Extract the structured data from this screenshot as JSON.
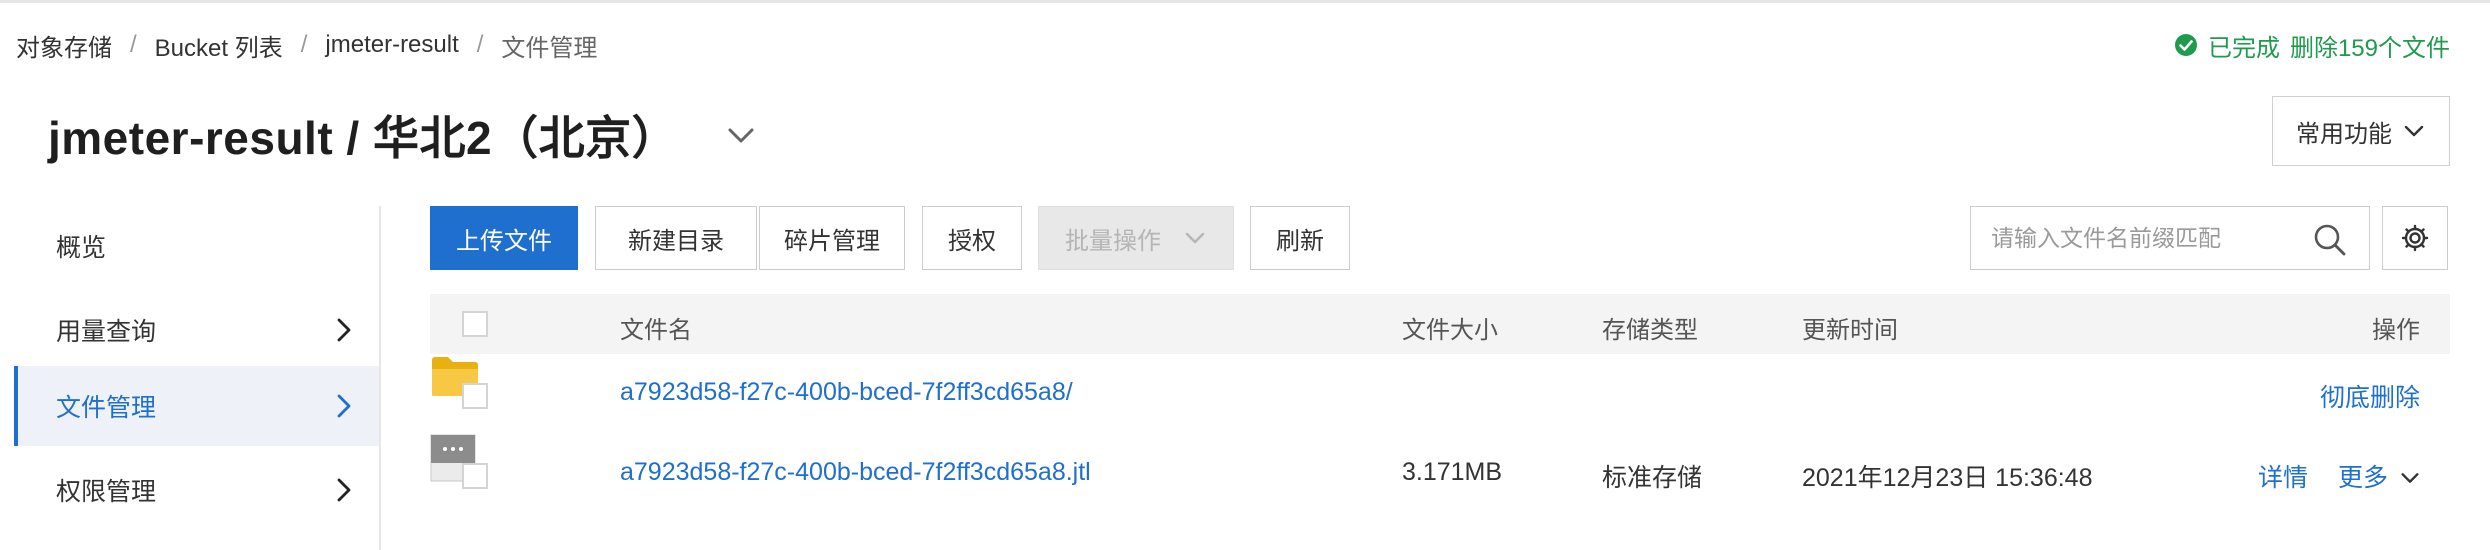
{
  "breadcrumb": [
    "对象存储",
    "Bucket 列表",
    "jmeter-result",
    "文件管理"
  ],
  "breadcrumb_separator": "/",
  "status": {
    "done": "已完成",
    "action": "删除159个文件",
    "color": "#1e9b4c"
  },
  "title": "jmeter-result / 华北2（北京）",
  "common_functions": "常用功能",
  "sidebar": {
    "items": [
      {
        "label": "概览"
      },
      {
        "label": "用量查询"
      },
      {
        "label": "文件管理"
      },
      {
        "label": "权限管理"
      }
    ],
    "active_index": 2
  },
  "toolbar": {
    "upload": "上传文件",
    "new_folder": "新建目录",
    "fragments": "碎片管理",
    "authorize": "授权",
    "batch": "批量操作",
    "refresh": "刷新",
    "search_placeholder": "请输入文件名前缀匹配"
  },
  "table": {
    "headers": {
      "name": "文件名",
      "size": "文件大小",
      "storage": "存储类型",
      "updated": "更新时间",
      "actions": "操作"
    },
    "rows": [
      {
        "type": "folder",
        "name": "a7923d58-f27c-400b-bced-7f2ff3cd65a8/",
        "size": "",
        "storage": "",
        "updated": "",
        "action_primary": "彻底删除",
        "action_more": ""
      },
      {
        "type": "file",
        "name": "a7923d58-f27c-400b-bced-7f2ff3cd65a8.jtl",
        "size": "3.171MB",
        "storage": "标准存储",
        "updated": "2021年12月23日 15:36:48",
        "action_primary": "详情",
        "action_more": "更多"
      }
    ]
  },
  "colors": {
    "accent": "#1f6fcf",
    "folder": "#f5c518"
  },
  "icons": [
    "check-circle-icon",
    "chevron-down-icon",
    "chevron-right-icon",
    "search-icon",
    "gear-icon",
    "folder-icon",
    "file-icon"
  ]
}
